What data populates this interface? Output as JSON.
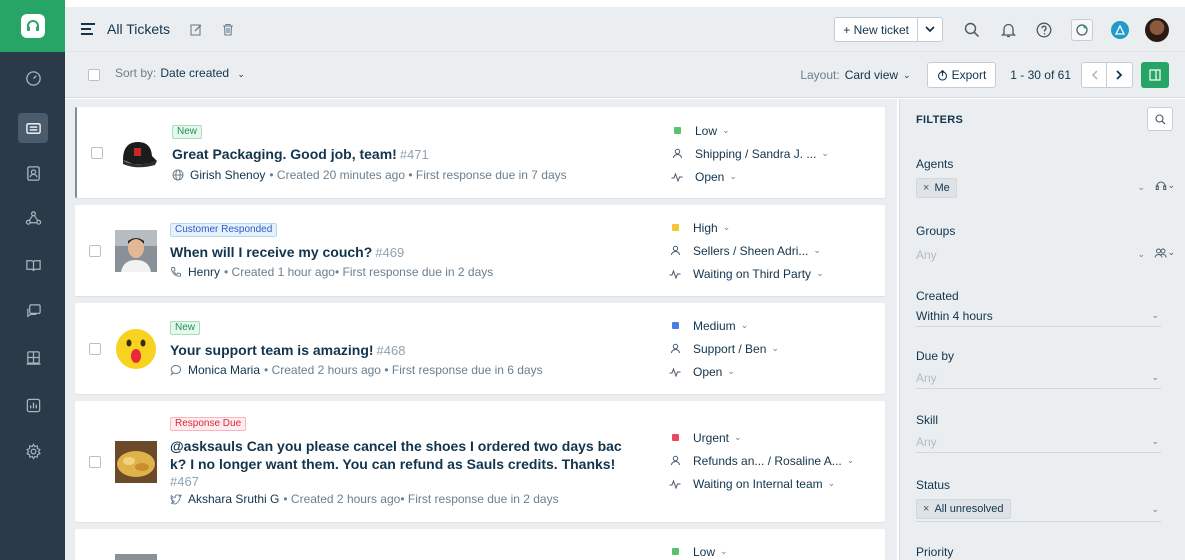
{
  "header": {
    "title": "All Tickets",
    "new_ticket_label": "+ New ticket"
  },
  "subheader": {
    "sort_label": "Sort by:",
    "sort_value": "Date created",
    "layout_label": "Layout:",
    "layout_value": "Card view",
    "export_label": "Export",
    "pagination": "1 - 30 of 61"
  },
  "tickets": [
    {
      "tag": "New",
      "subject": "Great Packaging. Good job, team!",
      "number": "#471",
      "requester": "Girish Shenoy",
      "created": "• Created 20 minutes ago",
      "due": "• First response due in 7 days",
      "priority": "Low",
      "priority_color": "#5bc06f",
      "group_agent": "Shipping / Sandra J. ...",
      "status": "Open"
    },
    {
      "tag": "Customer Responded",
      "subject": "When will I receive my couch?",
      "number": "#469",
      "requester": "Henry",
      "created": "• Created 1 hour ago",
      "due": "• First response due in 2 days",
      "priority": "High",
      "priority_color": "#f4c534",
      "group_agent": "Sellers / Sheen Adri...",
      "status": "Waiting on Third Party"
    },
    {
      "tag": "New",
      "subject": "Your support team is amazing!",
      "number": "#468",
      "requester": "Monica Maria",
      "created": "• Created 2 hours ago",
      "due": "• First response due in 6 days",
      "priority": "Medium",
      "priority_color": "#4d7be0",
      "group_agent": "Support / Ben",
      "status": "Open"
    },
    {
      "tag": "Response Due",
      "subject_line1": "@asksauls Can you please cancel the shoes I ordered two days bac",
      "subject_line2": "k? I no longer want them. You can refund as Sauls credits. Thanks!",
      "number": "#467",
      "requester": "Akshara Sruthi G",
      "created": "• Created 2 hours ago",
      "due": "• First response due in 2 days",
      "priority": "Urgent",
      "priority_color": "#e9495b",
      "group_agent": "Refunds an... / Rosaline A...",
      "status": "Waiting on Internal team"
    },
    {
      "priority": "Low",
      "priority_color": "#5bc06f"
    }
  ],
  "filters": {
    "title": "FILTERS",
    "agents_label": "Agents",
    "agents_chip": "Me",
    "groups_label": "Groups",
    "groups_placeholder": "Any",
    "created_label": "Created",
    "created_value": "Within 4 hours",
    "dueby_label": "Due by",
    "dueby_placeholder": "Any",
    "skill_label": "Skill",
    "skill_placeholder": "Any",
    "status_label": "Status",
    "status_chip": "All unresolved",
    "priority_label": "Priority"
  },
  "colors": {
    "brand_green": "#27a566",
    "nav_bg": "#2a3a48",
    "text_primary": "#12344d"
  }
}
